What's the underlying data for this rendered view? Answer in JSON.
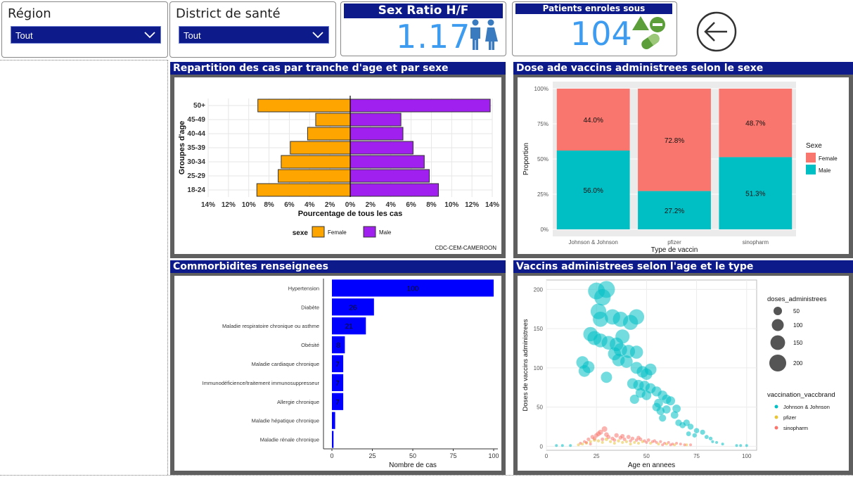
{
  "filters": {
    "region": {
      "title": "Région",
      "value": "Tout"
    },
    "district": {
      "title": "District de santé",
      "value": "Tout"
    }
  },
  "kpi_sex_ratio": {
    "title": "Sex Ratio H/F",
    "value": "1.17",
    "icon": "male-female-icon"
  },
  "kpi_patients": {
    "title": "Patients enroles sous medicaments",
    "value": "104",
    "icon": "pills-icon"
  },
  "back_button": {
    "icon": "back-arrow-icon"
  },
  "colors": {
    "navy": "#0d1a8a",
    "kpi_blue": "#3d9cf0",
    "female_orange": "#ffa500",
    "male_purple": "#a020f0",
    "pink": "#f8766d",
    "teal": "#00bfc4",
    "bar_blue": "#0000ff"
  },
  "panels": {
    "pyramid": {
      "title": "Repartition des cas par tranche d'age et par sexe"
    },
    "vaccine_sex": {
      "title": "Dose ade vaccins administrees selon le sexe"
    },
    "comorbid": {
      "title": "Commorbidites renseignees"
    },
    "vaccine_age": {
      "title": "Vaccins administrees selon l'age et le type"
    }
  },
  "chart_data": [
    {
      "type": "bar",
      "orientation": "horizontal-diverging",
      "categories": [
        "18-24",
        "25-29",
        "30-34",
        "35-39",
        "40-44",
        "45-49",
        "50+"
      ],
      "series": [
        {
          "name": "Female",
          "values": [
            9.2,
            7.1,
            6.8,
            5.9,
            4.2,
            3.4,
            9.1
          ]
        },
        {
          "name": "Male",
          "values": [
            8.7,
            7.8,
            7.3,
            6.2,
            5.2,
            5.0,
            13.8
          ]
        }
      ],
      "xlabel": "Pourcentage de tous les cas",
      "ylabel": "Groupes d'age",
      "xticks": [
        "14%",
        "12%",
        "10%",
        "8%",
        "6%",
        "4%",
        "2%",
        "0%",
        "2%",
        "4%",
        "6%",
        "8%",
        "10%",
        "12%",
        "14%"
      ],
      "xlim": [
        -14,
        14
      ],
      "legend_title": "sexe",
      "legend_position": "bottom",
      "caption": "CDC-CEM-CAMEROON",
      "grid": true
    },
    {
      "type": "bar",
      "orientation": "stacked-100",
      "categories": [
        "Johnson & Johnson",
        "pfizer",
        "sinopharm"
      ],
      "series": [
        {
          "name": "Female",
          "values": [
            44.0,
            72.8,
            48.7
          ]
        },
        {
          "name": "Male",
          "values": [
            56.0,
            27.2,
            51.3
          ]
        }
      ],
      "labels": {
        "Female": [
          "44.0%",
          "72.8%",
          "48.7%"
        ],
        "Male": [
          "56.0%",
          "27.2%",
          "51.3%"
        ]
      },
      "xlabel": "Type de vaccin",
      "ylabel": "Proportion",
      "yticks": [
        "0%",
        "25%",
        "50%",
        "75%",
        "100%"
      ],
      "ylim": [
        0,
        100
      ],
      "legend_title": "Sexe",
      "legend_position": "right",
      "grid": true
    },
    {
      "type": "bar",
      "orientation": "horizontal",
      "categories": [
        "Hypertension",
        "Diabète",
        "Maladie respiratoire chronique ou asthme",
        "Obésité",
        "Maladie cardiaque chronique",
        "Immunodéficience/traitement immunosuppresseur",
        "Allergie chronique",
        "Maladie hépatique chronique",
        "Maladie rénale chronique"
      ],
      "values": [
        100,
        26,
        21,
        8,
        7,
        7,
        7,
        2,
        1
      ],
      "labels": [
        "100",
        "26",
        "21",
        "8",
        "7",
        "7",
        "7",
        "",
        ""
      ],
      "xlabel": "Nombre de cas",
      "xticks": [
        "0",
        "25",
        "50",
        "75",
        "100"
      ],
      "xlim": [
        0,
        105
      ]
    },
    {
      "type": "scatter",
      "xlabel": "Age en annees",
      "ylabel": "Doses de vaccins administrees",
      "xlim": [
        0,
        105
      ],
      "ylim": [
        -5,
        212
      ],
      "xticks": [
        "0",
        "25",
        "50",
        "75",
        "100"
      ],
      "yticks": [
        "0",
        "50",
        "100",
        "150",
        "200"
      ],
      "size_legend": {
        "title": "doses_administrees",
        "labels": [
          "50",
          "100",
          "150",
          "200"
        ]
      },
      "color_legend": {
        "title": "vaccination_vaccbrand",
        "labels": [
          "Johnson & Johnson",
          "pfizer",
          "sinopharm"
        ],
        "colors": [
          "#00bfc4",
          "#e8c53a",
          "#f8766d"
        ]
      },
      "series": [
        {
          "name": "Johnson & Johnson",
          "points": [
            [
              30,
              200
            ],
            [
              25,
              198
            ],
            [
              28,
              190
            ],
            [
              26,
              172
            ],
            [
              27,
              162
            ],
            [
              33,
              165
            ],
            [
              37,
              162
            ],
            [
              42,
              158
            ],
            [
              45,
              165
            ],
            [
              22,
              143
            ],
            [
              24,
              138
            ],
            [
              27,
              135
            ],
            [
              31,
              132
            ],
            [
              35,
              130
            ],
            [
              38,
              140
            ],
            [
              34,
              118
            ],
            [
              37,
              123
            ],
            [
              41,
              121
            ],
            [
              45,
              120
            ],
            [
              36,
              110
            ],
            [
              40,
              108
            ],
            [
              18,
              107
            ],
            [
              21,
              101
            ],
            [
              19,
              96
            ],
            [
              30,
              88
            ],
            [
              45,
              100
            ],
            [
              48,
              95
            ],
            [
              50,
              92
            ],
            [
              52,
              98
            ],
            [
              43,
              80
            ],
            [
              46,
              78
            ],
            [
              49,
              77
            ],
            [
              52,
              74
            ],
            [
              55,
              70
            ],
            [
              47,
              68
            ],
            [
              50,
              65
            ],
            [
              44,
              60
            ],
            [
              58,
              65
            ],
            [
              60,
              60
            ],
            [
              56,
              55
            ],
            [
              62,
              58
            ],
            [
              55,
              50
            ],
            [
              57,
              45
            ],
            [
              60,
              47
            ],
            [
              65,
              48
            ],
            [
              58,
              36
            ],
            [
              64,
              40
            ],
            [
              66,
              30
            ],
            [
              68,
              27
            ],
            [
              70,
              30
            ],
            [
              72,
              25
            ],
            [
              75,
              20
            ],
            [
              71,
              16
            ],
            [
              74,
              14
            ],
            [
              78,
              18
            ],
            [
              80,
              12
            ],
            [
              82,
              10
            ],
            [
              83,
              6
            ],
            [
              85,
              5
            ],
            [
              88,
              3
            ],
            [
              95,
              1
            ],
            [
              97,
              1
            ],
            [
              100,
              1
            ],
            [
              5,
              1
            ],
            [
              8,
              1
            ],
            [
              12,
              1
            ]
          ]
        },
        {
          "name": "pfizer",
          "points": [
            [
              18,
              3
            ],
            [
              20,
              4
            ],
            [
              22,
              6
            ],
            [
              24,
              8
            ],
            [
              26,
              7
            ],
            [
              28,
              5
            ],
            [
              30,
              9
            ],
            [
              32,
              6
            ],
            [
              34,
              4
            ],
            [
              36,
              7
            ],
            [
              38,
              5
            ],
            [
              40,
              6
            ],
            [
              42,
              3
            ],
            [
              44,
              5
            ],
            [
              46,
              4
            ],
            [
              48,
              6
            ],
            [
              52,
              4
            ],
            [
              56,
              3
            ],
            [
              60,
              3
            ],
            [
              64,
              2
            ],
            [
              70,
              2
            ],
            [
              16,
              2
            ]
          ]
        },
        {
          "name": "sinopharm",
          "points": [
            [
              17,
              4
            ],
            [
              19,
              6
            ],
            [
              21,
              9
            ],
            [
              23,
              12
            ],
            [
              25,
              14
            ],
            [
              27,
              18
            ],
            [
              29,
              22
            ],
            [
              31,
              12
            ],
            [
              33,
              10
            ],
            [
              35,
              14
            ],
            [
              37,
              11
            ],
            [
              39,
              9
            ],
            [
              41,
              12
            ],
            [
              43,
              10
            ],
            [
              45,
              8
            ],
            [
              47,
              9
            ],
            [
              49,
              7
            ],
            [
              51,
              8
            ],
            [
              53,
              6
            ],
            [
              55,
              5
            ],
            [
              57,
              6
            ],
            [
              59,
              4
            ],
            [
              61,
              5
            ],
            [
              63,
              3
            ],
            [
              65,
              4
            ],
            [
              67,
              3
            ],
            [
              69,
              2
            ],
            [
              72,
              2
            ],
            [
              24,
              10
            ],
            [
              26,
              16
            ],
            [
              28,
              9
            ],
            [
              30,
              15
            ],
            [
              34,
              8
            ],
            [
              38,
              13
            ],
            [
              42,
              7
            ],
            [
              46,
              11
            ],
            [
              50,
              5
            ],
            [
              54,
              7
            ],
            [
              20,
              5
            ],
            [
              22,
              3
            ],
            [
              58,
              2
            ],
            [
              62,
              2
            ]
          ]
        }
      ]
    }
  ]
}
